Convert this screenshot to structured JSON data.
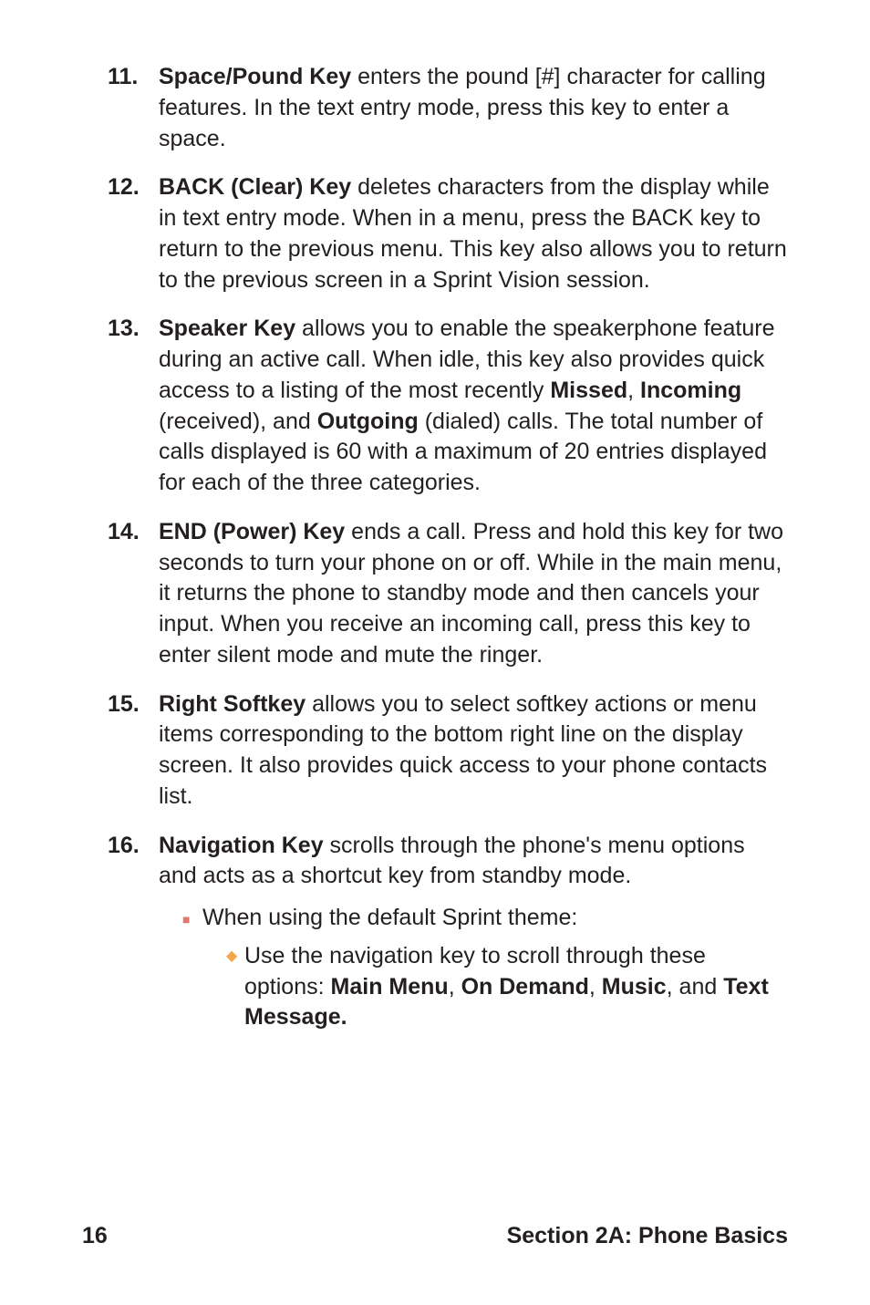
{
  "items": [
    {
      "num": "11.",
      "term": "Space/Pound Key",
      "text": " enters the pound [#] character for calling features. In the text entry mode, press this key to enter a space."
    },
    {
      "num": "12.",
      "term": "BACK (Clear) Key",
      "text": " deletes characters from the display while in text entry mode. When in a menu, press the BACK key to return to the previous menu. This key also allows you to return to the previous screen in a Sprint Vision session."
    },
    {
      "num": "13.",
      "term": "Speaker Key",
      "pre": " allows you to enable the speakerphone feature during an active call. When idle, this key also provides quick access to a listing of the most recently ",
      "b1": "Missed",
      "mid1": ", ",
      "b2": "Incoming",
      "mid2": " (received), and ",
      "b3": "Outgoing",
      "post": " (dialed) calls. The total number of calls displayed is 60 with a maximum of 20 entries displayed for each of the three categories."
    },
    {
      "num": "14.",
      "term": "END (Power) Key",
      "text": " ends a call. Press and hold this key for two seconds to turn your phone on or off. While in the main menu, it returns the phone to standby mode and then cancels your input. When you receive an incoming call, press this key to enter silent mode and mute the ringer."
    },
    {
      "num": "15.",
      "term": "Right Softkey",
      "text": " allows you to select softkey actions or menu items corresponding to the bottom right line on the display screen. It also provides quick access to your phone contacts list."
    },
    {
      "num": "16.",
      "term": "Navigation Key",
      "text": " scrolls through the phone's menu options and acts as a shortcut key from standby mode.",
      "sub1": {
        "text": "When using the default Sprint theme:",
        "sub2": {
          "pre": "Use the navigation key to scroll through these options: ",
          "b1": "Main Menu",
          "mid1": ", ",
          "b2": "On Demand",
          "mid2": ", ",
          "b3": "Music",
          "mid3": ", and ",
          "b4": "Text Message."
        }
      }
    }
  ],
  "footer": {
    "page": "16",
    "section": "Section 2A: Phone Basics"
  }
}
